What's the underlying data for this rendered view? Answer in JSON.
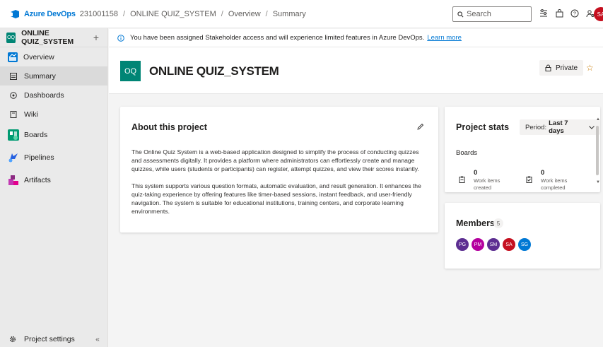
{
  "topbar": {
    "brand": "Azure DevOps",
    "org": "231001158",
    "breadcrumbs": [
      "ONLINE QUIZ_SYSTEM",
      "Overview",
      "Summary"
    ],
    "search_placeholder": "Search",
    "user_initials": "SA"
  },
  "sidebar": {
    "project_initials": "OQ",
    "project_name": "ONLINE QUIZ_SYSTEM",
    "items": [
      {
        "label": "Overview",
        "color": "#0078d4"
      },
      {
        "label": "Summary"
      },
      {
        "label": "Dashboards"
      },
      {
        "label": "Wiki"
      },
      {
        "label": "Boards",
        "color": "#009b72"
      },
      {
        "label": "Pipelines",
        "color": "#2560e0"
      },
      {
        "label": "Artifacts",
        "color": "#c239b3"
      }
    ],
    "settings_label": "Project settings",
    "collapse_glyph": "«"
  },
  "banner": {
    "message": "You have been assigned Stakeholder access and will experience limited features in Azure DevOps.",
    "link": "Learn more"
  },
  "header": {
    "initials": "OQ",
    "title": "ONLINE QUIZ_SYSTEM",
    "private_label": "Private"
  },
  "about": {
    "title": "About this project",
    "p1": "The Online Quiz System is a web-based application designed to simplify the process of conducting quizzes and assessments digitally. It provides a platform where administrators can effortlessly create and manage quizzes, while users (students or participants) can register, attempt quizzes, and view their scores instantly.",
    "p2": "This system supports various question formats, automatic evaluation, and result generation. It enhances the quiz-taking experience by offering features like timer-based sessions, instant feedback, and user-friendly navigation. The system is suitable for educational institutions, training centers, and corporate learning environments."
  },
  "stats": {
    "title": "Project stats",
    "period_prefix": "Period:",
    "period_value": "Last 7 days",
    "boards_label": "Boards",
    "items": [
      {
        "value": "0",
        "label": "Work items created"
      },
      {
        "value": "0",
        "label": "Work items completed"
      }
    ]
  },
  "members": {
    "title": "Members",
    "count": "5",
    "list": [
      {
        "initials": "PG",
        "color": "#5c2e91"
      },
      {
        "initials": "PM",
        "color": "#b4009e"
      },
      {
        "initials": "SM",
        "color": "#5c2e91"
      },
      {
        "initials": "SA",
        "color": "#c50f1f"
      },
      {
        "initials": "SG",
        "color": "#0078d4"
      }
    ]
  }
}
